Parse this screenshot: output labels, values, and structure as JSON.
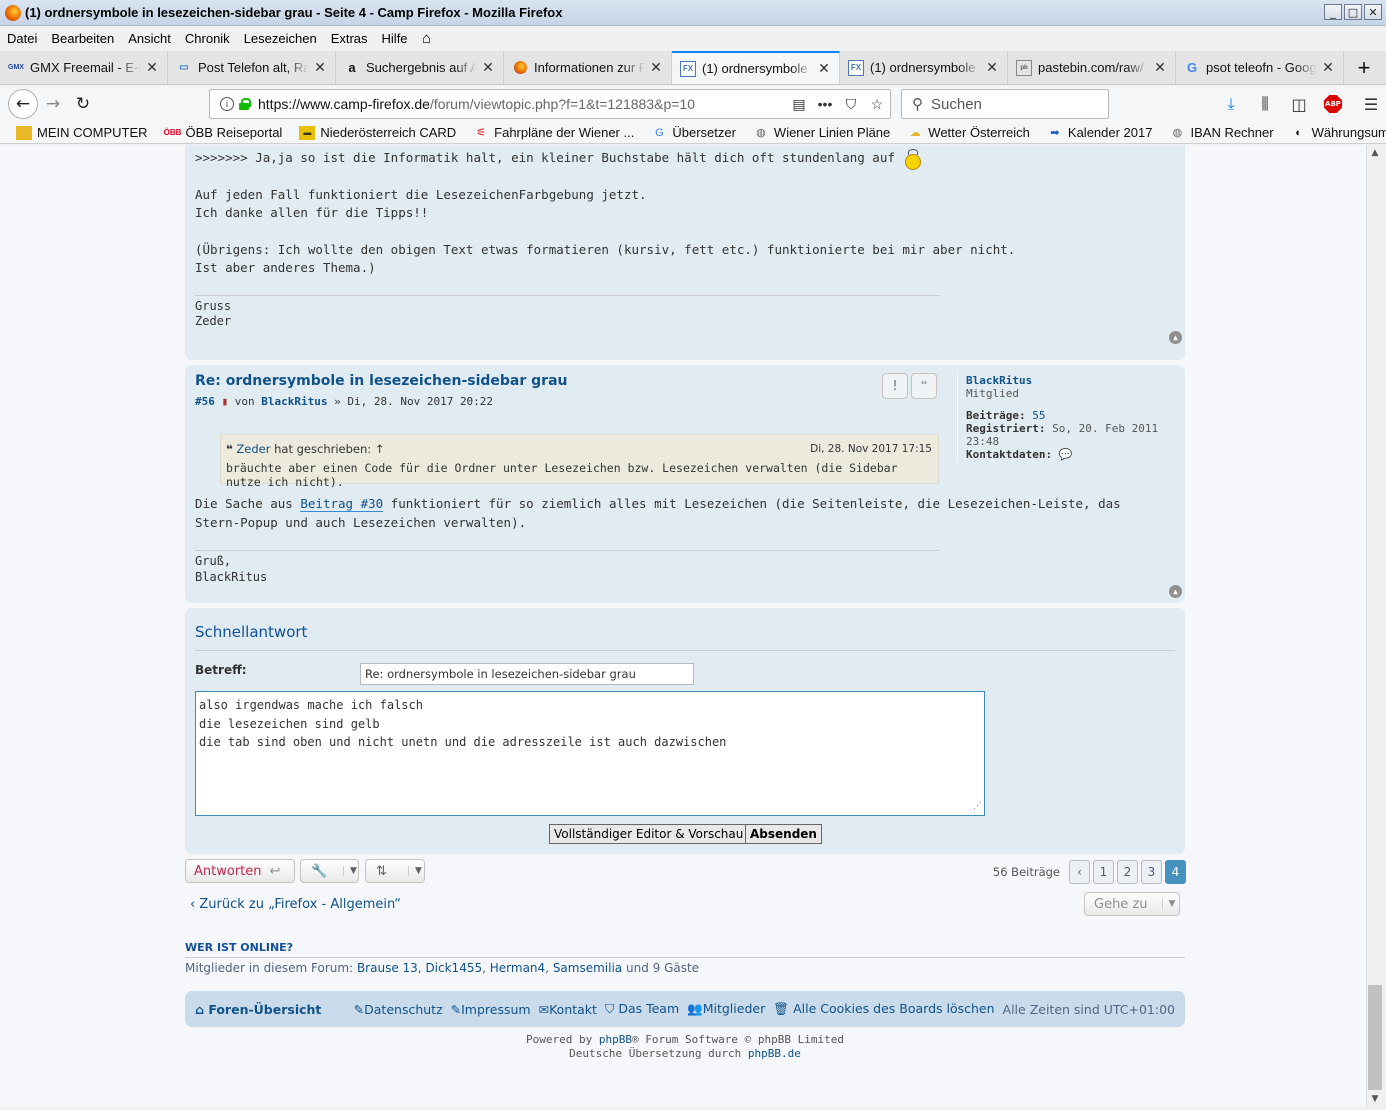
{
  "window": {
    "title": "(1) ordnersymbole in lesezeichen-sidebar grau - Seite 4 - Camp Firefox - Mozilla Firefox",
    "controls": [
      "_",
      "□",
      "✕"
    ]
  },
  "menubar": [
    "Datei",
    "Bearbeiten",
    "Ansicht",
    "Chronik",
    "Lesezeichen",
    "Extras",
    "Hilfe"
  ],
  "tabs": [
    {
      "label": "GMX Freemail - E-M",
      "icon": "GMX",
      "active": false
    },
    {
      "label": "Post Telefon alt, Rat",
      "icon": "💬",
      "active": false
    },
    {
      "label": "Suchergebnis auf Am",
      "icon": "a",
      "active": false
    },
    {
      "label": "Informationen zur F",
      "icon": "ff",
      "active": false
    },
    {
      "label": "(1) ordnersymbole",
      "icon": "FX",
      "active": true
    },
    {
      "label": "(1) ordnersymbole",
      "icon": "FX",
      "active": false
    },
    {
      "label": "pastebin.com/raw/",
      "icon": "pb",
      "active": false
    },
    {
      "label": "psot teleofn - Goog",
      "icon": "G",
      "active": false
    }
  ],
  "newtab_label": "+",
  "navbar": {
    "url_host": "https://www.camp-firefox.de",
    "url_path": "/forum/viewtopic.php?f=1&t=121883&p=10",
    "search_placeholder": "Suchen",
    "adblock_label": "ABP"
  },
  "bookmarks": [
    {
      "label": "MEIN COMPUTER",
      "icon": "folder-icon"
    },
    {
      "label": "ÖBB Reiseportal",
      "icon": "obb-icon"
    },
    {
      "label": "Niederösterreich CARD",
      "icon": "card-icon"
    },
    {
      "label": "Fahrpläne der Wiener ...",
      "icon": "wl-icon"
    },
    {
      "label": "Übersetzer",
      "icon": "translate-icon"
    },
    {
      "label": "Wiener Linien Pläne",
      "icon": "globe-icon"
    },
    {
      "label": "Wetter Österreich",
      "icon": "weather-icon"
    },
    {
      "label": "Kalender 2017",
      "icon": "arrow-icon"
    },
    {
      "label": "IBAN Rechner",
      "icon": "globe-icon"
    },
    {
      "label": "Währungsumrechner",
      "icon": "currency-icon"
    }
  ],
  "post1": {
    "line1": ">>>>>>> Ja,ja so ist die Informatik halt, ein kleiner Buchstabe hält dich oft stundenlang auf",
    "line2": "Auf jeden Fall funktioniert die LesezeichenFarbgebung jetzt.",
    "line3": "Ich danke allen für die Tipps!!",
    "line4": "(Übrigens: Ich wollte den obigen Text etwas formatieren (kursiv, fett etc.) funktionierte bei mir aber nicht.",
    "line5": "Ist aber anderes Thema.)",
    "sig1": "Gruss",
    "sig2": "Zeder"
  },
  "post2": {
    "title": "Re: ordnersymbole in lesezeichen-sidebar grau",
    "number": "#56",
    "by": "von",
    "author": "BlackRitus",
    "date": "» Di, 28. Nov 2017 20:22",
    "quote_author": "Zeder",
    "quote_wrote": "hat geschrieben: ↑",
    "quote_date": "Di, 28. Nov 2017 17:15",
    "quote_text": "bräuchte aber einen Code für die Ordner unter Lesezeichen bzw. Lesezeichen verwalten (die Sidebar nutze ich nicht).",
    "body_a": "Die Sache aus",
    "body_link": "Beitrag #30",
    "body_b": "funktioniert für so ziemlich alles mit Lesezeichen (die Seitenleiste, die Lesezeichen-Leiste, das",
    "body_c": "Stern-Popup und auch Lesezeichen verwalten).",
    "sig1": "Gruß,",
    "sig2": "BlackRitus",
    "report_label": "!",
    "quote_label": "❝"
  },
  "profile": {
    "name": "BlackRitus",
    "rank": "Mitglied",
    "posts_label": "Beiträge:",
    "posts": "55",
    "reg_label": "Registriert:",
    "reg": "So, 20. Feb 2011 23:48",
    "contact_label": "Kontaktdaten:"
  },
  "quickreply": {
    "heading": "Schnellantwort",
    "subject_label": "Betreff:",
    "subject": "Re: ordnersymbole in lesezeichen-sidebar grau",
    "body": [
      "also irgendwas mache ich falsch",
      "die lesezeichen sind gelb",
      "die tab sind oben und nicht unetn und die adresszeile ist auch dazwischen"
    ],
    "full_editor": "Vollständiger Editor & Vorschau",
    "submit": "Absenden"
  },
  "actions": {
    "reply": "Antworten",
    "count": "56 Beiträge",
    "pages": [
      "1",
      "2",
      "3",
      "4"
    ],
    "current_page": "4",
    "back": "Zurück zu „Firefox - Allgemein“",
    "goto": "Gehe zu"
  },
  "online": {
    "heading": "WER IST ONLINE?",
    "prefix": "Mitglieder in diesem Forum:",
    "members": [
      "Brause 13",
      "Dick1455",
      "Herman4",
      "Samsemilia"
    ],
    "suffix": "und 9 Gäste"
  },
  "footer": {
    "home": "Foren-Übersicht",
    "links": [
      "Datenschutz",
      "Impressum",
      "Kontakt",
      "Das Team",
      "Mitglieder",
      "Alle Cookies des Boards löschen"
    ],
    "tz": "Alle Zeiten sind UTC+01:00",
    "powered_a": "Powered by",
    "powered_link": "phpBB",
    "powered_b": "® Forum Software © phpBB Limited",
    "translation_a": "Deutsche Übersetzung durch",
    "translation_link": "phpBB.de"
  },
  "colors": {
    "accent": "#105289",
    "post_bg": "#e1ebf2",
    "active_tab": "#0a84ff"
  }
}
